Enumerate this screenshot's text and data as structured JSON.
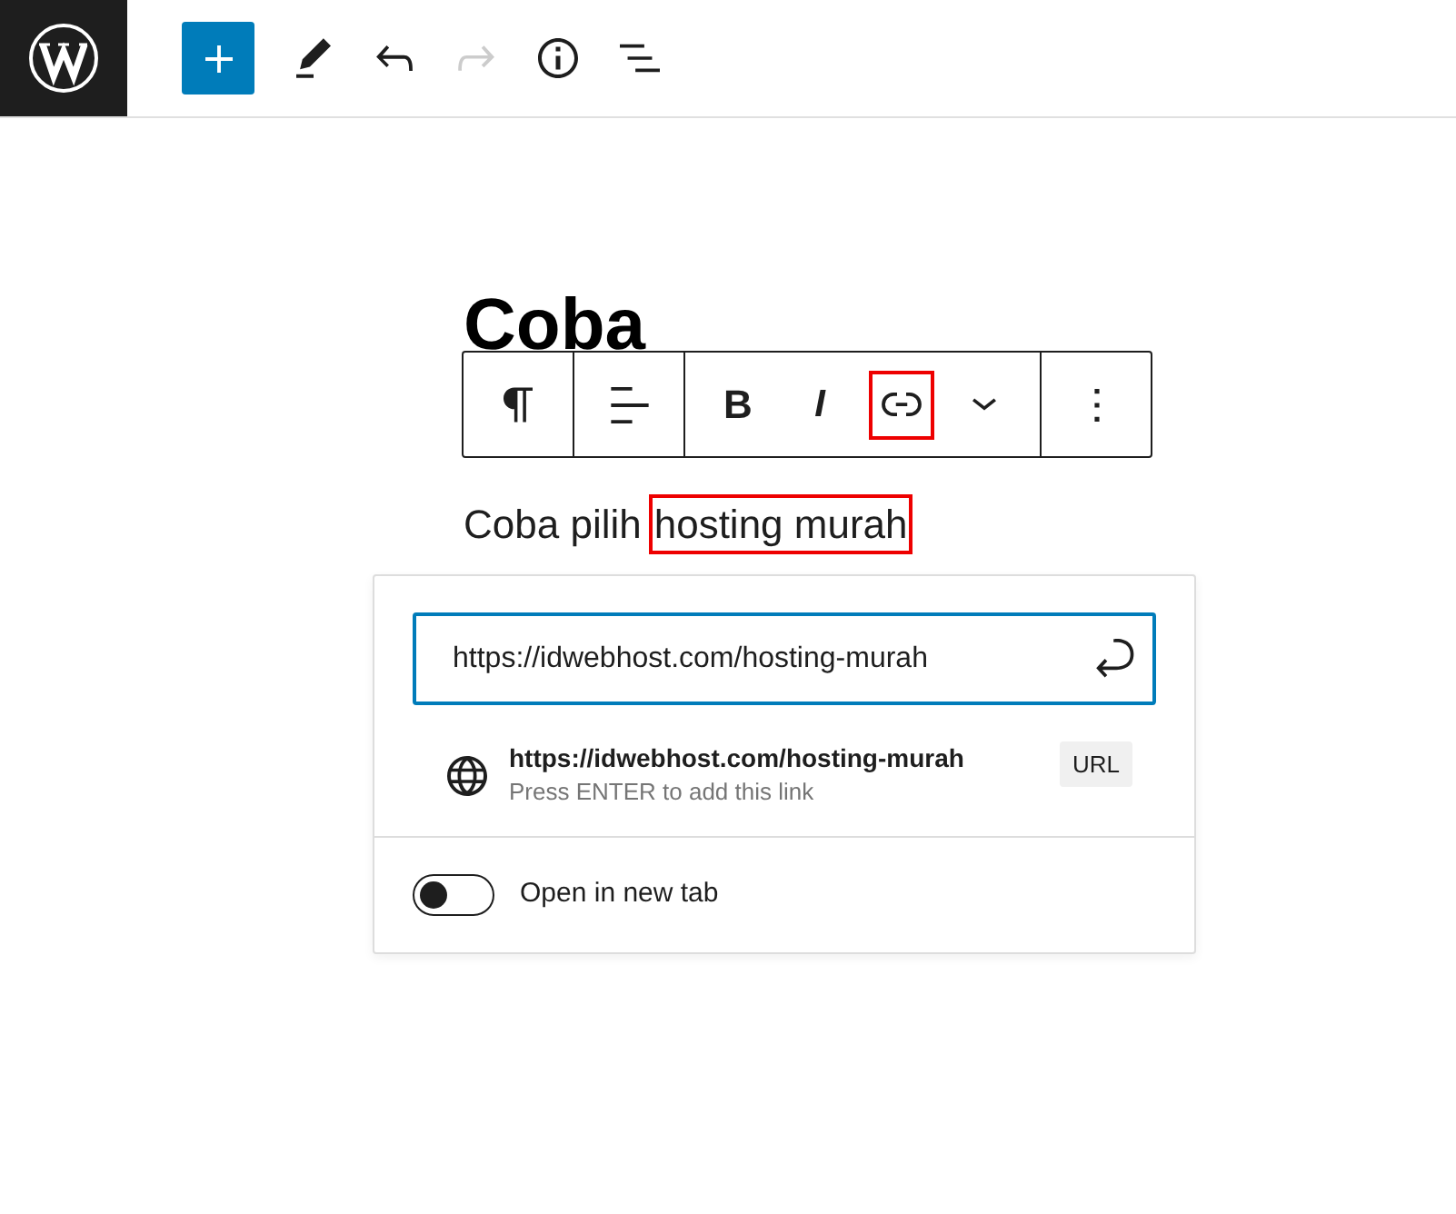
{
  "top_toolbar": [
    {
      "kind": "add",
      "disabled": false
    },
    {
      "kind": "tools",
      "disabled": false
    },
    {
      "kind": "undo",
      "disabled": false
    },
    {
      "kind": "redo",
      "disabled": true
    },
    {
      "kind": "details",
      "disabled": false
    },
    {
      "kind": "list_view",
      "disabled": false
    }
  ],
  "document": {
    "title": "Coba",
    "paragraph": [
      {
        "text": "Coba pilih",
        "annotated": false
      },
      {
        "text": "hosting murah",
        "annotated": true
      }
    ]
  },
  "block_toolbar": [
    [
      {
        "kind": "paragraph",
        "annotated": false
      }
    ],
    [
      {
        "kind": "align",
        "annotated": false
      }
    ],
    [
      {
        "kind": "bold",
        "label": "B",
        "annotated": false
      },
      {
        "kind": "italic",
        "label": "I",
        "annotated": false
      },
      {
        "kind": "link",
        "annotated": true
      },
      {
        "kind": "more",
        "annotated": false
      }
    ],
    [
      {
        "kind": "options",
        "annotated": false
      }
    ]
  ],
  "link_popover": {
    "url_field": {
      "value": "https://idwebhost.com/hosting-murah"
    },
    "suggestion": {
      "url": "https://idwebhost.com/hosting-murah",
      "hint": "Press ENTER to add this link",
      "type": "URL"
    },
    "new_tab_toggle": {
      "label": "Open in new tab",
      "on": false
    }
  }
}
